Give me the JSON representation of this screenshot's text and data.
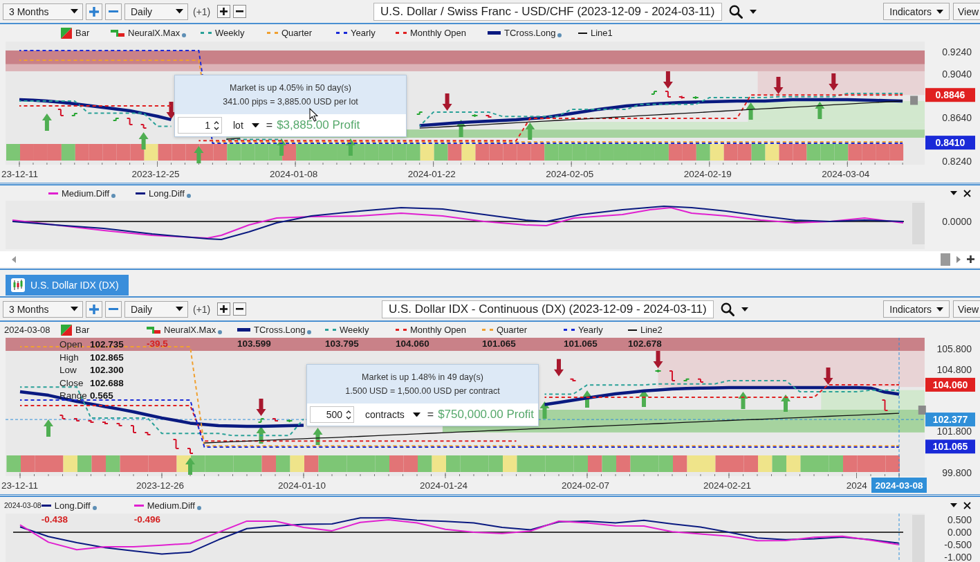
{
  "top_panel": {
    "toolbar": {
      "range": "3 Months",
      "interval": "Daily",
      "offset": "(+1)",
      "title": "U.S. Dollar / Swiss Franc - USD/CHF (2023-12-09 - 2024-03-11)",
      "indicators": "Indicators",
      "view": "View"
    },
    "price_chart": {
      "legend": [
        {
          "kind": "bar",
          "label": "Bar",
          "dot": false
        },
        {
          "kind": "neural",
          "label": "NeuralX.Max",
          "dot": true
        },
        {
          "kind": "dashed",
          "dot": false
        },
        {
          "kind": "dashed",
          "dot": false
        },
        {
          "kind": "dashed",
          "dot": false
        },
        {
          "kind": "dashed",
          "dot": false
        },
        {
          "kind": "thick",
          "dot": true
        },
        {
          "kind": "thin",
          "dot": false
        }
      ],
      "tooltip": {
        "lines": [
          "Market is up 4.05% in 50 day(s)",
          "341.00 pips = 3,885.00 USD per lot"
        ],
        "quantity": "1",
        "unit": "lot",
        "equals": "=",
        "profit": "$3,885.00 Profit"
      },
      "bar_marks": [
        {
          "color": "#7dc675",
          "kind": "plain"
        },
        {
          "color": "#e27476",
          "kind": "plain"
        },
        {
          "color": "#e27476",
          "kind": "up"
        },
        {
          "color": "#e27476",
          "kind": "plain"
        },
        {
          "color": "#7dc675",
          "kind": "plain"
        },
        {
          "color": "#e27476",
          "kind": "plain"
        },
        {
          "color": "#e27476",
          "kind": "plain"
        },
        {
          "color": "#e27476",
          "kind": "plain"
        },
        {
          "color": "#e27476",
          "kind": "plain"
        },
        {
          "color": "#e27476",
          "kind": "up"
        },
        {
          "color": "#efe48a",
          "kind": "plain"
        },
        {
          "color": "#e27476",
          "kind": "down"
        },
        {
          "color": "#e27476",
          "kind": "plain"
        },
        {
          "color": "#e27476",
          "kind": "up"
        },
        {
          "color": "#e27476",
          "kind": "plain"
        },
        {
          "color": "#e27476",
          "kind": "plain"
        },
        {
          "color": "#7dc675",
          "kind": "plain"
        },
        {
          "color": "#7dc675",
          "kind": "plain"
        },
        {
          "color": "#7dc675",
          "kind": "plain"
        },
        {
          "color": "#7dc675",
          "kind": "up"
        },
        {
          "color": "#e27476",
          "kind": "plain"
        },
        {
          "color": "#7dc675",
          "kind": "plain"
        },
        {
          "color": "#7dc675",
          "kind": "plain"
        },
        {
          "color": "#7dc675",
          "kind": "plain"
        },
        {
          "color": "#7dc675",
          "kind": "up"
        },
        {
          "color": "#7dc675",
          "kind": "plain"
        },
        {
          "color": "#7dc675",
          "kind": "plain"
        },
        {
          "color": "#7dc675",
          "kind": "plain"
        },
        {
          "color": "#7dc675",
          "kind": "plain"
        },
        {
          "color": "#7dc675",
          "kind": "plain"
        },
        {
          "color": "#efe48a",
          "kind": "plain"
        },
        {
          "color": "#7dc675",
          "kind": "down"
        },
        {
          "color": "#e27476",
          "kind": "up"
        },
        {
          "color": "#efe48a",
          "kind": "plain"
        },
        {
          "color": "#e27476",
          "kind": "plain"
        },
        {
          "color": "#e27476",
          "kind": "plain"
        },
        {
          "color": "#e27476",
          "kind": "plain"
        },
        {
          "color": "#e27476",
          "kind": "up"
        },
        {
          "color": "#e27476",
          "kind": "plain"
        },
        {
          "color": "#7dc675",
          "kind": "plain"
        },
        {
          "color": "#7dc675",
          "kind": "plain"
        },
        {
          "color": "#7dc675",
          "kind": "plain"
        },
        {
          "color": "#7dc675",
          "kind": "plain"
        },
        {
          "color": "#7dc675",
          "kind": "plain"
        },
        {
          "color": "#7dc675",
          "kind": "plain"
        },
        {
          "color": "#7dc675",
          "kind": "plain"
        },
        {
          "color": "#7dc675",
          "kind": "plain"
        },
        {
          "color": "#7dc675",
          "kind": "down"
        },
        {
          "color": "#e27476",
          "kind": "plain"
        },
        {
          "color": "#e27476",
          "kind": "plain"
        },
        {
          "color": "#7dc675",
          "kind": "plain"
        },
        {
          "color": "#efe48a",
          "kind": "plain"
        },
        {
          "color": "#e27476",
          "kind": "plain"
        },
        {
          "color": "#e27476",
          "kind": "up"
        },
        {
          "color": "#7dc675",
          "kind": "plain"
        },
        {
          "color": "#efe48a",
          "kind": "down"
        },
        {
          "color": "#e27476",
          "kind": "plain"
        },
        {
          "color": "#e27476",
          "kind": "plain"
        },
        {
          "color": "#7dc675",
          "kind": "up"
        },
        {
          "color": "#7dc675",
          "kind": "down"
        },
        {
          "color": "#7dc675",
          "kind": "plain"
        },
        {
          "color": "#e27476",
          "kind": "plain"
        },
        {
          "color": "#e27476",
          "kind": "plain"
        },
        {
          "color": "#e27476",
          "kind": "plain"
        },
        {
          "color": "#e27476",
          "kind": "plain"
        }
      ],
      "chart_data": {
        "type": "line",
        "categories": [
          "23-12-11",
          null,
          null,
          null,
          null,
          null,
          null,
          null,
          null,
          null,
          "2023-12-25",
          null,
          null,
          null,
          null,
          null,
          null,
          null,
          null,
          null,
          "2024-01-08",
          null,
          null,
          null,
          null,
          null,
          null,
          null,
          null,
          null,
          "2024-01-22",
          null,
          null,
          null,
          null,
          null,
          null,
          null,
          null,
          null,
          "2024-02-05",
          null,
          null,
          null,
          null,
          null,
          null,
          null,
          null,
          null,
          "2024-02-19",
          null,
          null,
          null,
          null,
          null,
          null,
          null,
          null,
          null,
          "2024-03-04",
          null,
          null,
          null,
          null
        ],
        "ylim": [
          0.8208,
          0.9335
        ],
        "yticks": [
          {
            "value": 0.924,
            "label": "0.9240"
          },
          {
            "value": 0.904,
            "label": "0.9040"
          },
          {
            "value": 0.864,
            "label": "0.8640"
          },
          {
            "value": 0.824,
            "label": "0.8240"
          }
        ],
        "series": [
          {
            "name": "Weekly",
            "color": "#2aa198",
            "line_style": "dashed",
            "values": [
              0.8791,
              0.8791,
              0.8791,
              0.8791,
              0.8791,
              0.868,
              0.868,
              0.868,
              0.868,
              0.868,
              0.856,
              0.856,
              null,
              null,
              null,
              0.844,
              0.844,
              0.844,
              0.844,
              0.844,
              null,
              null,
              null,
              null,
              null,
              null,
              null,
              null,
              null,
              0.856,
              0.869,
              0.869,
              0.869,
              0.869,
              0.869,
              0.865,
              0.865,
              0.865,
              0.865,
              0.865,
              0.8715,
              0.8715,
              0.8715,
              0.8715,
              0.8715,
              0.876,
              0.876,
              0.876,
              0.876,
              0.876,
              0.8822,
              0.8822,
              0.8822,
              0.8822,
              0.8822,
              0.883,
              0.883,
              0.883,
              0.883,
              0.883,
              0.886,
              0.886,
              0.886,
              0.886,
              0.886
            ]
          },
          {
            "name": "Quarter",
            "color": "#f0a030",
            "line_style": "dashed",
            "values": [
              0.9164,
              0.9164,
              0.9164,
              0.9164,
              0.9164,
              0.9164,
              0.9164,
              0.9164,
              0.9164,
              0.9164,
              0.9164,
              0.9164,
              0.9164,
              0.9164,
              0.8416,
              0.8416,
              0.8416,
              0.8416,
              0.8416,
              0.8416,
              0.8416,
              0.8416,
              0.8416,
              0.8416,
              0.8416,
              0.8416,
              0.8416,
              0.8416,
              0.8416,
              0.8416,
              0.8416,
              0.8416,
              0.8416,
              0.8416,
              0.8416,
              0.8416,
              0.8416,
              0.8416,
              0.8416,
              0.8416,
              0.8416,
              0.8416,
              0.8416,
              0.8416,
              0.8416,
              0.8416,
              0.8416,
              0.8416,
              0.8416,
              0.8416,
              0.8416,
              0.8416,
              0.8416,
              0.8416,
              0.8416,
              0.8416,
              0.8416,
              0.8416,
              0.8416,
              0.8416,
              0.8416,
              0.8416,
              0.8416,
              0.8416,
              0.8416
            ]
          },
          {
            "name": "Yearly",
            "color": "#1a2ad8",
            "line_style": "dashed",
            "values": [
              0.9253,
              0.9253,
              0.9253,
              0.9253,
              0.9253,
              0.9253,
              0.9253,
              0.9253,
              0.9253,
              0.9253,
              0.9253,
              0.9253,
              0.9253,
              0.9253,
              0.8404,
              0.8404,
              0.8404,
              0.8404,
              0.8404,
              0.8404,
              0.8404,
              0.8404,
              0.8404,
              0.8404,
              0.8404,
              0.8404,
              0.8404,
              0.8404,
              0.8404,
              0.8404,
              0.8404,
              0.8404,
              0.8404,
              0.8404,
              0.8404,
              0.8404,
              0.8404,
              0.8404,
              0.8404,
              0.8404,
              0.8404,
              0.8404,
              0.8404,
              0.8404,
              0.8404,
              0.8404,
              0.8404,
              0.8404,
              0.8404,
              0.8404,
              0.8404,
              0.8404,
              0.8404,
              0.8404,
              0.8404,
              0.8404,
              0.8404,
              0.8404,
              0.8404,
              0.8404,
              0.8404,
              0.8404,
              0.8404,
              0.8404,
              0.8404
            ]
          },
          {
            "name": "Monthly Open",
            "color": "#e02020",
            "line_style": "dashed",
            "values": [
              0.8746,
              0.8746,
              0.8746,
              0.8746,
              0.8746,
              0.8746,
              0.8746,
              0.8746,
              0.8746,
              0.8746,
              0.8746,
              0.8746,
              null,
              0.8428,
              0.8428,
              0.8428,
              0.8428,
              0.8428,
              0.8428,
              0.8428,
              0.8428,
              0.8428,
              0.8428,
              0.8428,
              0.8428,
              0.8428,
              0.8428,
              0.8428,
              0.8428,
              0.8428,
              0.8428,
              0.8428,
              0.8428,
              0.8428,
              0.8428,
              0.8428,
              0.8428,
              0.8632,
              0.8632,
              0.8632,
              0.8632,
              0.8632,
              0.8632,
              0.8632,
              0.8632,
              0.8632,
              0.8632,
              0.8632,
              0.8632,
              0.8632,
              0.8632,
              0.8632,
              0.8632,
              0.8846,
              0.8846,
              0.8846,
              0.8846,
              0.8846,
              0.8846,
              0.8846,
              0.8846,
              0.8846,
              0.8846,
              0.8846,
              0.8846
            ]
          },
          {
            "name": "TCross.Long",
            "color": "#0a1a80",
            "values": [
              0.8804,
              0.8798,
              0.8791,
              0.8779,
              0.8766,
              0.875,
              0.8734,
              0.8718,
              0.8702,
              0.8677,
              0.8651,
              0.862,
              null,
              null,
              null,
              null,
              null,
              null,
              null,
              null,
              null,
              null,
              null,
              null,
              null,
              null,
              null,
              null,
              null,
              0.8566,
              0.8575,
              0.8585,
              0.8594,
              0.8601,
              0.8607,
              0.8614,
              0.862,
              0.863,
              0.8639,
              0.8658,
              0.8677,
              0.8696,
              0.8715,
              0.8731,
              0.8746,
              0.8756,
              0.8766,
              0.8772,
              0.8778,
              0.8781,
              0.8784,
              0.8788,
              0.8791,
              0.8791,
              0.8791,
              0.8797,
              0.8803,
              0.8803,
              0.8803,
              0.8803,
              0.8803,
              0.88,
              0.8797,
              0.8794,
              0.8791
            ]
          },
          {
            "name": "Line1",
            "color": "#111111",
            "values": [
              null,
              null,
              null,
              null,
              null,
              null,
              null,
              null,
              null,
              null,
              null,
              null,
              null,
              null,
              null,
              0.8442,
              0.8449,
              null,
              null,
              null,
              null,
              null,
              null,
              null,
              null,
              null,
              null,
              null,
              null,
              0.8542,
              0.8549,
              0.8556,
              0.8563,
              0.857,
              0.8577,
              0.8585,
              0.8592,
              0.8599,
              0.8606,
              0.8613,
              0.862,
              0.8627,
              0.8634,
              0.8642,
              0.8649,
              0.8656,
              0.8663,
              0.867,
              0.8677,
              0.8684,
              0.8691,
              0.8699,
              0.8706,
              0.8713,
              0.872,
              0.8727,
              0.8734,
              0.8741,
              0.8748,
              0.8756,
              0.8763,
              0.877,
              0.8777,
              0.8784,
              0.8791
            ]
          }
        ],
        "annotations": [
          "0.8846",
          "0.8410"
        ]
      }
    },
    "diff_chart": {
      "legend": [
        {
          "label": "Medium.Diff",
          "kind": "line",
          "color": "#e020d0",
          "dot": true
        },
        {
          "label": "Long.Diff",
          "kind": "line",
          "color": "#0a1a80",
          "dot": true
        }
      ],
      "axis_label": "0.0000"
    }
  },
  "tabs": [
    {
      "label": "U.S. Dollar IDX (DX)",
      "selected": true
    }
  ],
  "bottom_panel": {
    "toolbar": {
      "range": "3 Months",
      "interval": "Daily",
      "offset": "(+1)",
      "title": "U.S. Dollar IDX - Continuous (DX) (2023-12-09 - 2024-03-11)",
      "indicators": "Indicators",
      "view": "View"
    },
    "price_chart": {
      "date": "2024-03-08",
      "legend": [
        {
          "kind": "bar",
          "label": "Bar",
          "dot": false
        },
        {
          "kind": "neural",
          "label": "NeuralX.Max",
          "dot": true,
          "value": "-39.5",
          "negative": true
        },
        {
          "kind": "thick",
          "dot": true,
          "value": "103.599",
          "negative": false
        },
        {
          "kind": "dashed",
          "dot": false,
          "value": "103.795",
          "negative": false
        },
        {
          "kind": "dashed",
          "dot": false,
          "value": "104.060",
          "negative": false
        },
        {
          "kind": "dashed",
          "dot": false,
          "value": "101.065",
          "negative": false
        },
        {
          "kind": "dashed",
          "dot": false,
          "value": "101.065",
          "negative": false
        },
        {
          "kind": "thin",
          "dot": false,
          "value": "102.678",
          "negative": false
        }
      ],
      "ohlc": [
        {
          "label": "Open",
          "value": "102.735"
        },
        {
          "label": "High",
          "value": "102.865"
        },
        {
          "label": "Low",
          "value": "102.300"
        },
        {
          "label": "Close",
          "value": "102.688"
        },
        {
          "label": "Range",
          "value": "0.565"
        }
      ],
      "tooltip": {
        "lines": [
          "Market is up 1.48% in 49 day(s)",
          "1.500 USD = 1,500.00 USD per contract"
        ],
        "quantity": "500",
        "unit": "contracts",
        "equals": "=",
        "profit": "$750,000.00 Profit"
      },
      "bar_marks": [
        {
          "color": "#7dc675",
          "kind": "plain"
        },
        {
          "color": "#e27476",
          "kind": "plain"
        },
        {
          "color": "#e27476",
          "kind": "up"
        },
        {
          "color": "#e27476",
          "kind": "plain"
        },
        {
          "color": "#efe48a",
          "kind": "plain"
        },
        {
          "color": "#7dc675",
          "kind": "plain"
        },
        {
          "color": "#e27476",
          "kind": "plain"
        },
        {
          "color": "#7dc675",
          "kind": "plain"
        },
        {
          "color": "#e27476",
          "kind": "plain"
        },
        {
          "color": "#e27476",
          "kind": "plain"
        },
        {
          "color": "#e27476",
          "kind": "plain"
        },
        {
          "color": "#e27476",
          "kind": "plain"
        },
        {
          "color": "#efe48a",
          "kind": "up"
        },
        {
          "color": "#7dc675",
          "kind": "plain"
        },
        {
          "color": "#7dc675",
          "kind": "plain"
        },
        {
          "color": "#7dc675",
          "kind": "plain"
        },
        {
          "color": "#7dc675",
          "kind": "plain"
        },
        {
          "color": "#7dc675",
          "kind": "both"
        },
        {
          "color": "#e27476",
          "kind": "plain"
        },
        {
          "color": "#7dc675",
          "kind": "plain"
        },
        {
          "color": "#efe48a",
          "kind": "plain"
        },
        {
          "color": "#e27476",
          "kind": "up"
        },
        {
          "color": "#7dc675",
          "kind": "plain"
        },
        {
          "color": "#7dc675",
          "kind": "plain"
        },
        {
          "color": "#7dc675",
          "kind": "plain"
        },
        {
          "color": "#7dc675",
          "kind": "plain"
        },
        {
          "color": "#7dc675",
          "kind": "plain"
        },
        {
          "color": "#e27476",
          "kind": "plain"
        },
        {
          "color": "#e27476",
          "kind": "plain"
        },
        {
          "color": "#7dc675",
          "kind": "plain"
        },
        {
          "color": "#efe48a",
          "kind": "plain"
        },
        {
          "color": "#7dc675",
          "kind": "plain"
        },
        {
          "color": "#7dc675",
          "kind": "plain"
        },
        {
          "color": "#7dc675",
          "kind": "plain"
        },
        {
          "color": "#7dc675",
          "kind": "plain"
        },
        {
          "color": "#efe48a",
          "kind": "plain"
        },
        {
          "color": "#7dc675",
          "kind": "plain"
        },
        {
          "color": "#7dc675",
          "kind": "up"
        },
        {
          "color": "#7dc675",
          "kind": "down"
        },
        {
          "color": "#7dc675",
          "kind": "plain"
        },
        {
          "color": "#7dc675",
          "kind": "up"
        },
        {
          "color": "#e27476",
          "kind": "plain"
        },
        {
          "color": "#7dc675",
          "kind": "plain"
        },
        {
          "color": "#e27476",
          "kind": "plain"
        },
        {
          "color": "#7dc675",
          "kind": "up"
        },
        {
          "color": "#7dc675",
          "kind": "down"
        },
        {
          "color": "#7dc675",
          "kind": "plain"
        },
        {
          "color": "#e27476",
          "kind": "plain"
        },
        {
          "color": "#efe48a",
          "kind": "plain"
        },
        {
          "color": "#efe48a",
          "kind": "plain"
        },
        {
          "color": "#e27476",
          "kind": "plain"
        },
        {
          "color": "#e27476",
          "kind": "up"
        },
        {
          "color": "#e27476",
          "kind": "plain"
        },
        {
          "color": "#efe48a",
          "kind": "plain"
        },
        {
          "color": "#7dc675",
          "kind": "up"
        },
        {
          "color": "#efe48a",
          "kind": "plain"
        },
        {
          "color": "#7dc675",
          "kind": "plain"
        },
        {
          "color": "#7dc675",
          "kind": "down"
        },
        {
          "color": "#7dc675",
          "kind": "plain"
        },
        {
          "color": "#e27476",
          "kind": "plain"
        },
        {
          "color": "#e27476",
          "kind": "plain"
        },
        {
          "color": "#e27476",
          "kind": "plain"
        },
        {
          "color": "#e27476",
          "kind": "plain"
        }
      ],
      "chart_data": {
        "type": "line",
        "categories": [
          "23-12-11",
          null,
          null,
          null,
          null,
          null,
          null,
          null,
          null,
          null,
          "2023-12-26",
          null,
          null,
          null,
          null,
          null,
          null,
          null,
          null,
          null,
          "2024-01-10",
          null,
          null,
          null,
          null,
          null,
          null,
          null,
          null,
          null,
          "2024-01-24",
          null,
          null,
          null,
          null,
          null,
          null,
          null,
          null,
          null,
          "2024-02-07",
          null,
          null,
          null,
          null,
          null,
          null,
          null,
          null,
          null,
          "2024-02-21",
          null,
          null,
          null,
          null,
          null,
          null,
          null,
          null,
          "2024",
          null,
          null,
          "2024-03-08"
        ],
        "ylim": [
          99.632,
          106.336
        ],
        "yticks": [
          {
            "value": 105.8,
            "label": "105.800"
          },
          {
            "value": 104.8,
            "label": "104.800"
          },
          {
            "value": 101.8,
            "label": "101.800"
          },
          {
            "value": 99.8,
            "label": "99.800"
          }
        ],
        "series": [
          {
            "name": "TCross.Long",
            "color": "#0a1a80",
            "values": [
              103.72,
              103.64,
              103.55,
              103.4,
              103.25,
              103.13,
              103.0,
              102.88,
              102.75,
              102.6,
              102.45,
              102.33,
              102.2,
              102.14,
              102.08,
              102.06,
              102.05,
              102.05,
              102.06,
              102.08,
              102.1,
              null,
              null,
              null,
              null,
              null,
              null,
              null,
              null,
              null,
              null,
              null,
              null,
              null,
              null,
              null,
              null,
              103.1,
              103.2,
              103.31,
              103.42,
              103.52,
              103.62,
              103.69,
              103.76,
              103.81,
              103.86,
              103.88,
              103.9,
              103.91,
              103.92,
              103.92,
              103.92,
              103.92,
              103.92,
              103.92,
              103.92,
              103.92,
              103.92,
              103.92,
              103.9,
              103.7,
              103.6
            ]
          },
          {
            "name": "Weekly",
            "color": "#2aa198",
            "line_style": "dashed",
            "values": [
              103.95,
              103.95,
              103.95,
              103.95,
              103.95,
              102.45,
              102.45,
              102.45,
              102.45,
              102.45,
              101.7,
              101.7,
              101.7,
              101.7,
              101.7,
              101.6,
              101.6,
              101.6,
              101.6,
              101.6,
              102.4,
              null,
              null,
              null,
              null,
              null,
              null,
              null,
              null,
              null,
              null,
              null,
              null,
              null,
              null,
              null,
              null,
              103.6,
              103.6,
              103.6,
              104.05,
              104.05,
              104.05,
              104.05,
              104.05,
              104.1,
              104.1,
              104.1,
              104.1,
              104.1,
              104.26,
              104.26,
              104.26,
              104.26,
              104.26,
              103.72,
              103.72,
              103.72,
              103.72,
              103.72,
              103.8,
              103.8,
              103.8
            ]
          },
          {
            "name": "Monthly Open",
            "color": "#e02020",
            "line_style": "dashed",
            "values": [
              103.05,
              103.05,
              103.05,
              103.05,
              103.05,
              103.05,
              103.05,
              103.05,
              103.05,
              103.05,
              103.05,
              103.05,
              103.05,
              101.33,
              101.33,
              101.33,
              101.33,
              101.33,
              101.33,
              101.33,
              101.33,
              101.33,
              101.33,
              101.33,
              101.33,
              101.33,
              101.33,
              101.33,
              101.33,
              101.33,
              101.33,
              101.33,
              101.33,
              101.33,
              101.33,
              101.33,
              null,
              103.45,
              103.45,
              103.45,
              103.45,
              103.45,
              103.45,
              103.45,
              103.45,
              103.45,
              103.45,
              103.45,
              103.45,
              103.45,
              103.45,
              103.45,
              103.45,
              103.45,
              103.45,
              103.45,
              103.45,
              104.06,
              104.06,
              104.06,
              104.06,
              104.06,
              104.06
            ]
          },
          {
            "name": "Quarter",
            "color": "#f0a030",
            "line_style": "dashed",
            "values": [
              105.9,
              105.9,
              105.9,
              105.9,
              105.9,
              105.9,
              105.9,
              105.9,
              105.9,
              105.9,
              105.9,
              105.9,
              105.9,
              101.1,
              101.1,
              101.1,
              101.1,
              101.1,
              101.1,
              101.1,
              101.1,
              101.1,
              101.1,
              101.1,
              101.1,
              101.1,
              101.1,
              101.1,
              101.1,
              101.1,
              101.1,
              101.1,
              101.1,
              101.1,
              101.1,
              101.1,
              101.1,
              101.1,
              101.1,
              101.1,
              101.1,
              101.1,
              101.1,
              101.1,
              101.1,
              101.1,
              101.1,
              101.1,
              101.1,
              101.1,
              101.1,
              101.1,
              101.1,
              101.1,
              101.1,
              101.1,
              101.1,
              101.1,
              101.1,
              101.1,
              101.1,
              101.1,
              101.1
            ]
          },
          {
            "name": "Yearly",
            "color": "#1a2ad8",
            "line_style": "dashed",
            "values": [
              103.32,
              103.32,
              103.32,
              103.32,
              103.32,
              103.32,
              103.32,
              103.32,
              103.32,
              103.32,
              103.32,
              103.32,
              103.32,
              101.04,
              101.04,
              101.04,
              101.04,
              101.04,
              101.04,
              101.04,
              101.04,
              101.04,
              101.04,
              101.04,
              101.04,
              101.04,
              101.04,
              101.04,
              101.04,
              101.04,
              101.04,
              101.04,
              101.04,
              101.04,
              101.04,
              101.04,
              101.04,
              101.04,
              101.04,
              101.04,
              101.04,
              101.04,
              101.04,
              101.04,
              101.04,
              101.04,
              101.04,
              101.04,
              101.04,
              101.04,
              101.04,
              101.04,
              101.04,
              101.04,
              101.04,
              101.04,
              101.04,
              101.04,
              101.04,
              101.04,
              101.04,
              101.04,
              101.04
            ]
          },
          {
            "name": "Line2",
            "color": "#111111",
            "values": [
              null,
              null,
              null,
              null,
              null,
              null,
              null,
              null,
              null,
              null,
              null,
              null,
              null,
              101.24,
              101.27,
              101.3,
              101.33,
              101.36,
              101.39,
              101.42,
              101.45,
              101.48,
              101.5,
              101.53,
              101.56,
              101.59,
              101.62,
              101.65,
              101.68,
              101.71,
              101.74,
              101.77,
              101.8,
              101.83,
              101.86,
              101.89,
              101.92,
              101.94,
              101.97,
              102.0,
              102.03,
              102.06,
              102.09,
              102.12,
              102.15,
              102.18,
              102.21,
              102.24,
              102.27,
              102.3,
              102.33,
              102.36,
              102.38,
              102.41,
              102.44,
              102.47,
              102.5,
              102.53,
              102.56,
              102.59,
              102.62,
              102.65,
              102.68
            ]
          }
        ],
        "ref_lines": [
          {
            "axis": "y",
            "value": 102.377,
            "color": "#2f8fd8"
          }
        ],
        "annotations": [
          "104.060",
          "102.377",
          "101.065"
        ]
      }
    },
    "diff_chart": {
      "date": "2024-03-08",
      "legend": [
        {
          "kind": "line",
          "dot": true,
          "value": "-0.438",
          "negative": true
        },
        {
          "kind": "line",
          "dot": true,
          "value": "-0.496",
          "negative": true
        }
      ],
      "chart_data": {
        "type": "line",
        "ylim": [
          -1.197,
          0.754
        ],
        "yticks": [
          {
            "value": 0.5,
            "label": "0.500"
          },
          {
            "value": 0,
            "label": "0.000"
          },
          {
            "value": -0.5,
            "label": "-0.500"
          },
          {
            "value": -1,
            "label": "-1.000"
          }
        ],
        "series": [
          {
            "name": "Long.Diff",
            "color": "#0a1a80",
            "values": [
              0.22,
              -0.17,
              -0.42,
              -0.62,
              -0.75,
              -0.88,
              -0.8,
              -0.3,
              0.15,
              0.25,
              0.32,
              0.34,
              0.58,
              0.58,
              0.48,
              0.44,
              0.38,
              0.2,
              0.1,
              0.42,
              0.45,
              0.38,
              0.48,
              0.34,
              0.21,
              0.0,
              -0.23,
              -0.3,
              -0.26,
              -0.19,
              -0.3,
              -0.44
            ]
          },
          {
            "name": "Medium.Diff",
            "color": "#e020d0",
            "values": [
              0.3,
              -0.4,
              -0.7,
              -0.58,
              -0.58,
              -0.52,
              -0.45,
              0.0,
              0.45,
              0.45,
              0.2,
              0.06,
              0.4,
              0.5,
              0.38,
              0.12,
              0.0,
              -0.05,
              0.05,
              0.45,
              0.38,
              0.26,
              0.25,
              0.02,
              -0.07,
              -0.16,
              -0.34,
              -0.33,
              -0.2,
              -0.16,
              -0.32,
              -0.5
            ]
          }
        ],
        "ref_lines": [
          {
            "axis": "y",
            "value": 0,
            "color": "#000000"
          }
        ]
      }
    }
  }
}
